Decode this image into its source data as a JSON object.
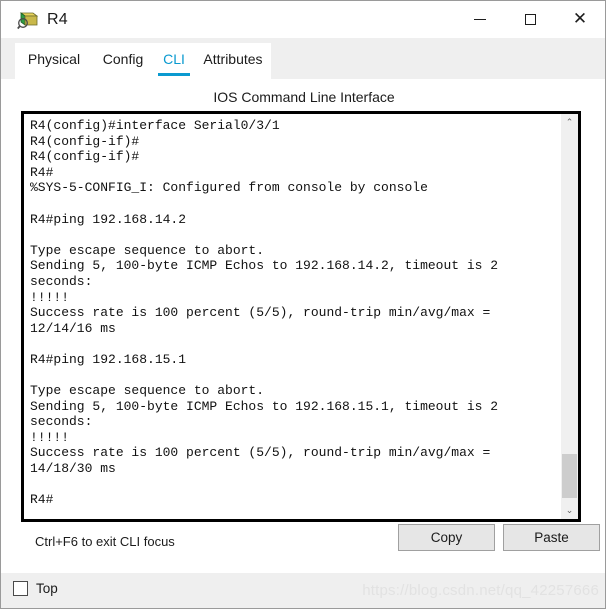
{
  "window": {
    "title": "R4",
    "icon": "router-icon",
    "controls": {
      "minimize": "—",
      "maximize": "□",
      "close": "✕"
    }
  },
  "tabs": [
    {
      "label": "Physical",
      "active": false
    },
    {
      "label": "Config",
      "active": false
    },
    {
      "label": "CLI",
      "active": true
    },
    {
      "label": "Attributes",
      "active": false
    }
  ],
  "panel": {
    "heading": "IOS Command Line Interface",
    "terminal_text": "R4(config)#interface Serial0/3/1\nR4(config-if)#\nR4(config-if)#\nR4#\n%SYS-5-CONFIG_I: Configured from console by console\n\nR4#ping 192.168.14.2\n\nType escape sequence to abort.\nSending 5, 100-byte ICMP Echos to 192.168.14.2, timeout is 2\nseconds:\n!!!!!\nSuccess rate is 100 percent (5/5), round-trip min/avg/max =\n12/14/16 ms\n\nR4#ping 192.168.15.1\n\nType escape sequence to abort.\nSending 5, 100-byte ICMP Echos to 192.168.15.1, timeout is 2\nseconds:\n!!!!!\nSuccess rate is 100 percent (5/5), round-trip min/avg/max =\n14/18/30 ms\n\nR4#"
  },
  "scrollbar": {
    "up_arrow": "⌃",
    "down_arrow": "⌄"
  },
  "footer": {
    "hint": "Ctrl+F6 to exit CLI focus",
    "copy_label": "Copy",
    "paste_label": "Paste"
  },
  "bottom": {
    "top_checkbox_label": "Top",
    "top_checked": false,
    "watermark": "https://blog.csdn.net/qq_42257666"
  },
  "colors": {
    "accent": "#0a9ad0",
    "chrome": "#efefef",
    "button": "#e6e6e6",
    "terminal_text": "#111111",
    "watermark": "#e2e2e2"
  }
}
